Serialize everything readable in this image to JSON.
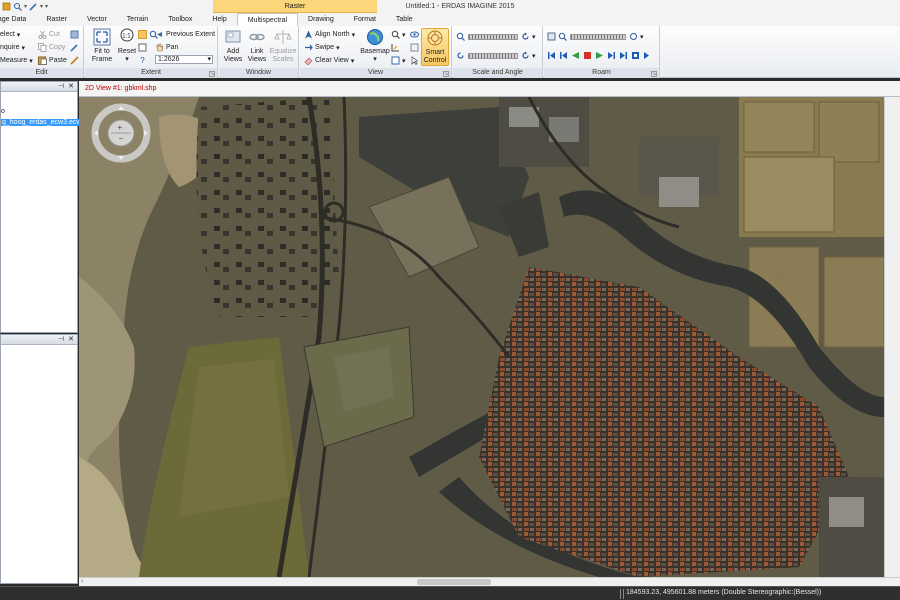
{
  "app": {
    "title": "Untitled:1 - ERDAS IMAGINE 2015",
    "context_group": "Raster"
  },
  "tabs": [
    "nage Data",
    "Raster",
    "Vector",
    "Terrain",
    "Toolbox",
    "Help",
    "Multispectral",
    "Drawing",
    "Format",
    "Table"
  ],
  "ribbon": {
    "edit": {
      "label": "Edit",
      "select": "elect",
      "inquire": "nquire",
      "measure": "Measure",
      "cut": "Cut",
      "copy": "Copy",
      "paste": "Paste"
    },
    "extent": {
      "label": "Extent",
      "fit_to_frame": "Fit to\nFrame",
      "reset": "Reset",
      "previous_extent": "Previous Extent",
      "pan": "Pan",
      "scale": "1:2626"
    },
    "window": {
      "label": "Window",
      "add_views": "Add\nViews",
      "link_views": "Link\nViews",
      "equalize_scales": "Equalize\nScales"
    },
    "view": {
      "label": "View",
      "align_north": "Align North",
      "swipe": "Swipe",
      "clear_view": "Clear View",
      "basemap": "Basemap",
      "smart_control": "Smart\nControl"
    },
    "scale_and_angle": {
      "label": "Scale and Angle"
    },
    "roam": {
      "label": "Roam"
    }
  },
  "contents": {
    "item_0": "o",
    "item_1": "g_hoog_erdas_ecw3.ecw"
  },
  "view": {
    "title": "2D View #1: gbkml.shp"
  },
  "status": {
    "coords": "184593.23, 495601.88 meters (Double Stereographic:(Bessel))"
  },
  "colors": {
    "accent": "#fbd67a",
    "selection": "#3399ff",
    "view_title": "#bb0000"
  }
}
